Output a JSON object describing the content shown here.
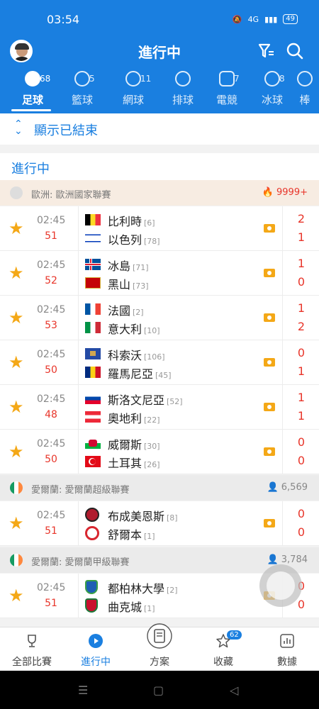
{
  "status_bar": {
    "time": "03:54",
    "battery": "49",
    "network": "4G"
  },
  "header": {
    "title": "進行中"
  },
  "tabs": [
    {
      "label": "足球",
      "count": "68",
      "icon": "soccer-ball-icon",
      "active": true
    },
    {
      "label": "籃球",
      "count": "5",
      "icon": "basketball-icon"
    },
    {
      "label": "網球",
      "count": "11",
      "icon": "tennis-ball-icon"
    },
    {
      "label": "排球",
      "count": "",
      "icon": "volleyball-icon"
    },
    {
      "label": "電競",
      "count": "7",
      "icon": "gamepad-icon"
    },
    {
      "label": "冰球",
      "count": "8",
      "icon": "ice-hockey-icon"
    },
    {
      "label": "棒",
      "count": "",
      "icon": "baseball-icon"
    }
  ],
  "show_ended": {
    "label": "顯示已結束"
  },
  "section_title": "進行中",
  "leagues": [
    {
      "name": "歐洲: 歐洲國家聯賽",
      "meta": "9999+",
      "meta_icon": "fire-icon",
      "matches": [
        {
          "time": "02:45",
          "minute": "51",
          "home": "比利時",
          "home_rank": "[6]",
          "away": "以色列",
          "away_rank": "[78]",
          "home_score": "2",
          "away_score": "1"
        },
        {
          "time": "02:45",
          "minute": "52",
          "home": "冰島",
          "home_rank": "[71]",
          "away": "黑山",
          "away_rank": "[73]",
          "home_score": "1",
          "away_score": "0"
        },
        {
          "time": "02:45",
          "minute": "53",
          "home": "法國",
          "home_rank": "[2]",
          "away": "意大利",
          "away_rank": "[10]",
          "home_score": "1",
          "away_score": "2"
        },
        {
          "time": "02:45",
          "minute": "50",
          "home": "科索沃",
          "home_rank": "[106]",
          "away": "羅馬尼亞",
          "away_rank": "[45]",
          "home_score": "0",
          "away_score": "1"
        },
        {
          "time": "02:45",
          "minute": "48",
          "home": "斯洛文尼亞",
          "home_rank": "[52]",
          "away": "奧地利",
          "away_rank": "[22]",
          "home_score": "1",
          "away_score": "1"
        },
        {
          "time": "02:45",
          "minute": "50",
          "home": "威爾斯",
          "home_rank": "[30]",
          "away": "土耳其",
          "away_rank": "[26]",
          "home_score": "0",
          "away_score": "0"
        }
      ]
    },
    {
      "name": "愛爾蘭: 愛爾蘭超級聯賽",
      "meta": "6,569",
      "meta_icon": "users-icon",
      "matches": [
        {
          "time": "02:45",
          "minute": "51",
          "home": "布成美恩斯",
          "home_rank": "[8]",
          "away": "舒爾本",
          "away_rank": "[1]",
          "home_score": "0",
          "away_score": "0"
        }
      ]
    },
    {
      "name": "愛爾蘭: 愛爾蘭甲級聯賽",
      "meta": "3,784",
      "meta_icon": "users-icon",
      "matches": [
        {
          "time": "02:45",
          "minute": "51",
          "home": "都柏林大學",
          "home_rank": "[2]",
          "away": "曲克城",
          "away_rank": "[1]",
          "home_score": "0",
          "away_score": "0"
        }
      ]
    }
  ],
  "bottom_nav": [
    {
      "label": "全部比賽",
      "icon": "trophy-icon"
    },
    {
      "label": "進行中",
      "icon": "play-icon",
      "active": true
    },
    {
      "label": "方案",
      "icon": "document-icon"
    },
    {
      "label": "收藏",
      "icon": "star-icon",
      "badge": "62"
    },
    {
      "label": "數據",
      "icon": "chart-icon"
    }
  ]
}
